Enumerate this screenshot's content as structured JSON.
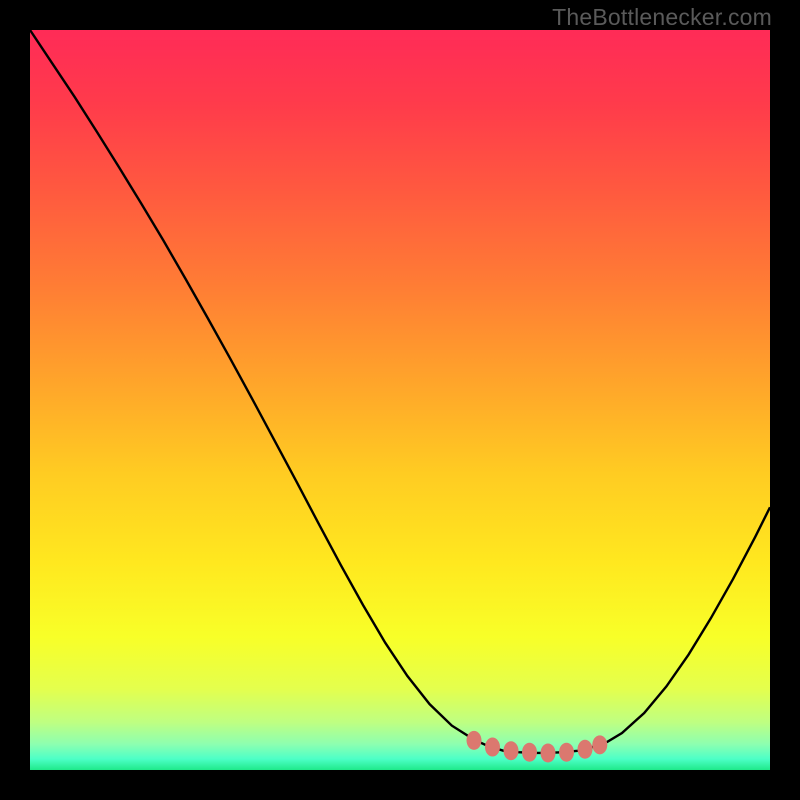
{
  "watermark": "TheBottlenecker.com",
  "colors": {
    "background": "#000000",
    "curve_stroke": "#000000",
    "marker_fill": "#db786f",
    "watermark": "#5a5a5a",
    "gradient_stops": [
      {
        "offset": 0.0,
        "color": "#ff2b57"
      },
      {
        "offset": 0.1,
        "color": "#ff3b4b"
      },
      {
        "offset": 0.22,
        "color": "#ff5a3f"
      },
      {
        "offset": 0.35,
        "color": "#ff7e34"
      },
      {
        "offset": 0.48,
        "color": "#ffa62a"
      },
      {
        "offset": 0.6,
        "color": "#ffcc22"
      },
      {
        "offset": 0.72,
        "color": "#ffe81f"
      },
      {
        "offset": 0.82,
        "color": "#f8ff28"
      },
      {
        "offset": 0.89,
        "color": "#e4ff4d"
      },
      {
        "offset": 0.935,
        "color": "#bfff81"
      },
      {
        "offset": 0.965,
        "color": "#8dffb0"
      },
      {
        "offset": 0.985,
        "color": "#4dffc7"
      },
      {
        "offset": 1.0,
        "color": "#1fe98a"
      }
    ]
  },
  "chart_data": {
    "type": "line",
    "title": "",
    "xlabel": "",
    "ylabel": "",
    "xlim": [
      0,
      100
    ],
    "ylim": [
      0,
      100
    ],
    "x": [
      0,
      3,
      6,
      9,
      12,
      15,
      18,
      21,
      24,
      27,
      30,
      33,
      36,
      39,
      42,
      45,
      48,
      51,
      54,
      57,
      60,
      62,
      64,
      66,
      68,
      70,
      72,
      74,
      76,
      78,
      80,
      83,
      86,
      89,
      92,
      95,
      98,
      100
    ],
    "values": [
      100,
      95.5,
      91,
      86.3,
      81.5,
      76.6,
      71.6,
      66.4,
      61.1,
      55.7,
      50.2,
      44.6,
      39,
      33.3,
      27.7,
      22.3,
      17.2,
      12.7,
      8.9,
      6.0,
      4.1,
      3.2,
      2.6,
      2.4,
      2.3,
      2.3,
      2.4,
      2.6,
      3.1,
      3.8,
      5.0,
      7.7,
      11.3,
      15.6,
      20.5,
      25.8,
      31.5,
      35.5
    ],
    "trough_markers_x": [
      60,
      62.5,
      65,
      67.5,
      70,
      72.5,
      75,
      77
    ],
    "trough_markers_y": [
      4.0,
      3.1,
      2.6,
      2.4,
      2.3,
      2.4,
      2.8,
      3.4
    ]
  }
}
